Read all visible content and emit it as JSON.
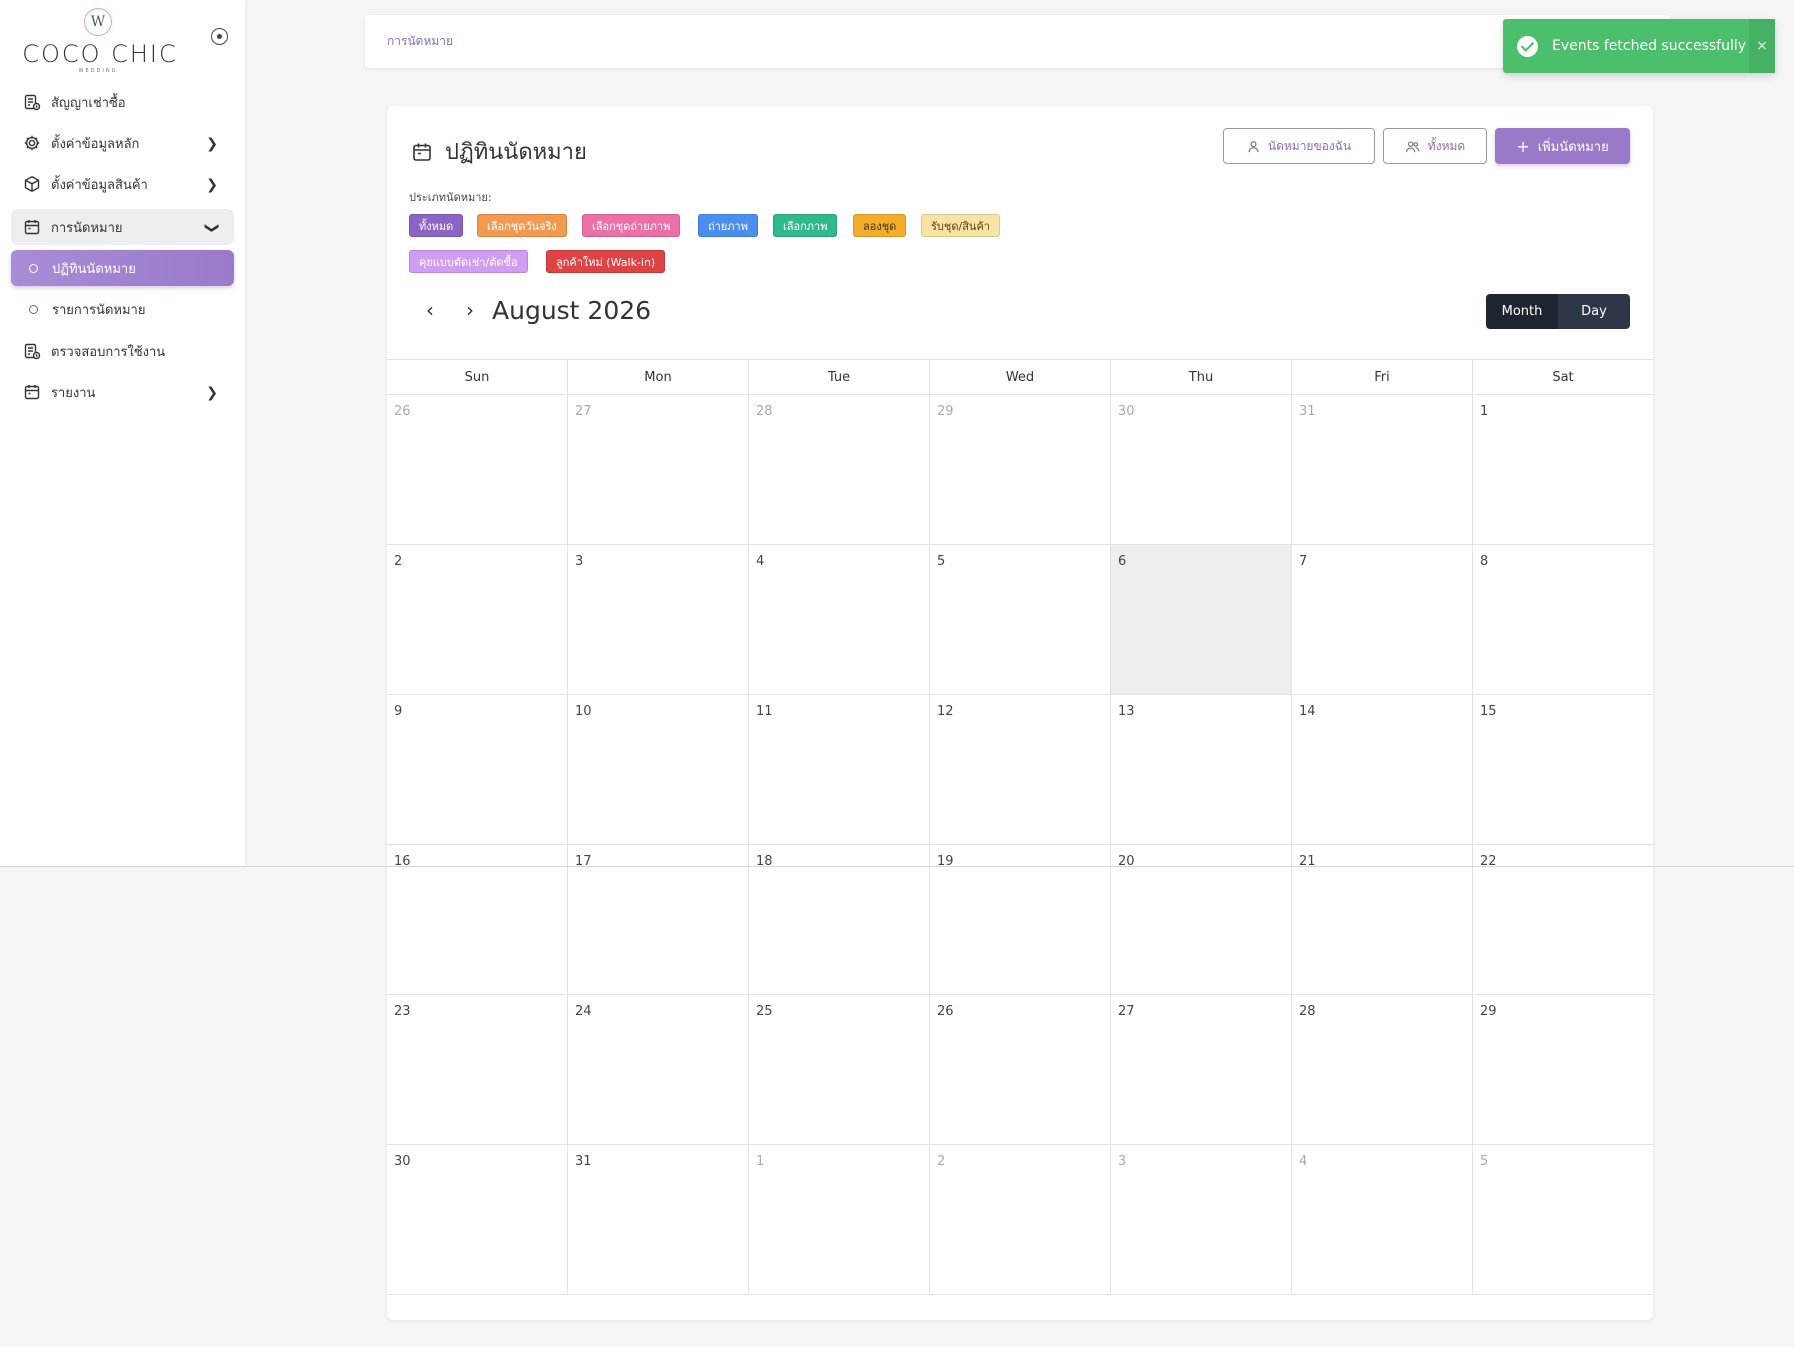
{
  "brand": {
    "mark": "W",
    "name": "COCO CHIC",
    "sub": "WEDDING"
  },
  "sidebar": {
    "items": [
      {
        "label": "สัญญาเช่าซื้อ",
        "icon": "contract-icon"
      },
      {
        "label": "ตั้งค่าข้อมูลหลัก",
        "icon": "gear-icon"
      },
      {
        "label": "ตั้งค่าข้อมูลสินค้า",
        "icon": "box-icon"
      },
      {
        "label": "การนัดหมาย",
        "icon": "calendar-icon"
      },
      {
        "label": "ปฏิทินนัดหมาย"
      },
      {
        "label": "รายการนัดหมาย"
      },
      {
        "label": "ตรวจสอบการใช้งาน",
        "icon": "audit-icon"
      },
      {
        "label": "รายงาน",
        "icon": "report-calendar-icon"
      }
    ]
  },
  "topbar": {
    "breadcrumb": "การนัดหมาย"
  },
  "toast": {
    "message": "Events fetched successfully",
    "close": "×",
    "color": "#4bbf6b"
  },
  "page": {
    "title": "ปฏิทินนัดหมาย",
    "my_appointments": "นัดหมายของฉัน",
    "all": "ทั้งหมด",
    "add": "เพิ่มนัดหมาย",
    "type_label": "ประเภทนัดหมาย:",
    "chips": [
      {
        "label": "ทั้งหมด",
        "bg": "#8c64c4",
        "fg": "#ffffff"
      },
      {
        "label": "เลือกชุดวันจริง",
        "bg": "#f29a4f",
        "fg": "#ffffff"
      },
      {
        "label": "เลือกชุดถ่ายภาพ",
        "bg": "#ec6fa8",
        "fg": "#ffffff"
      },
      {
        "label": "ถ่ายภาพ",
        "bg": "#4b8ef0",
        "fg": "#ffffff"
      },
      {
        "label": "เลือกภาพ",
        "bg": "#2fb98c",
        "fg": "#ffffff"
      },
      {
        "label": "ลองชุด",
        "bg": "#f3ad2c",
        "fg": "#4a3300"
      },
      {
        "label": "รับชุด/สินค้า",
        "bg": "#f7e3a4",
        "fg": "#5a4510"
      },
      {
        "label": "คุยแบบตัดเช่า/ตัดซื้อ",
        "bg": "#cf9ef0",
        "fg": "#ffffff"
      },
      {
        "label": "ลูกค้าใหม่ (Walk-in)",
        "bg": "#e04343",
        "fg": "#ffffff"
      }
    ],
    "month": "August 2026",
    "view_month": "Month",
    "view_day": "Day"
  },
  "calendar": {
    "weekdays": [
      "Sun",
      "Mon",
      "Tue",
      "Wed",
      "Thu",
      "Fri",
      "Sat"
    ],
    "weeks": [
      [
        "26",
        "27",
        "28",
        "29",
        "30",
        "31",
        "1"
      ],
      [
        "2",
        "3",
        "4",
        "5",
        "6",
        "7",
        "8"
      ],
      [
        "9",
        "10",
        "11",
        "12",
        "13",
        "14",
        "15"
      ],
      [
        "16",
        "17",
        "18",
        "19",
        "20",
        "21",
        "22"
      ],
      [
        "23",
        "24",
        "25",
        "26",
        "27",
        "28",
        "29"
      ],
      [
        "30",
        "31",
        "1",
        "2",
        "3",
        "4",
        "5"
      ]
    ],
    "muted": [
      [
        1,
        1,
        1,
        1,
        1,
        1,
        0
      ],
      [
        0,
        0,
        0,
        0,
        0,
        0,
        0
      ],
      [
        0,
        0,
        0,
        0,
        0,
        0,
        0
      ],
      [
        0,
        0,
        0,
        0,
        0,
        0,
        0
      ],
      [
        0,
        0,
        0,
        0,
        0,
        0,
        0
      ],
      [
        0,
        0,
        1,
        1,
        1,
        1,
        1
      ]
    ],
    "today": "6"
  },
  "colors": {
    "accent": "#9a79c8",
    "breadcrumb": "#8a6db5",
    "dark": "#1e2430"
  }
}
